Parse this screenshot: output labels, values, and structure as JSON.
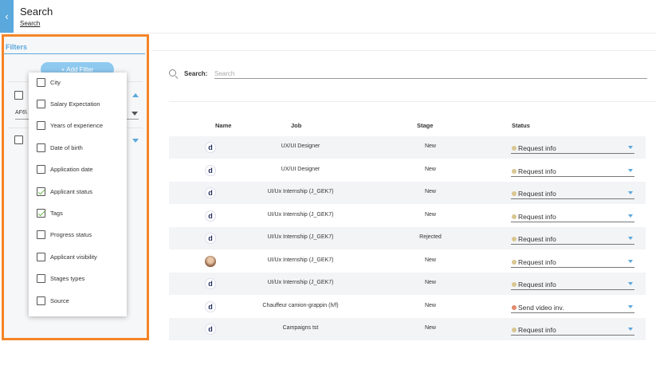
{
  "header": {
    "back_icon": "chevron-left-icon",
    "title": "Search",
    "breadcrumb": "Search"
  },
  "filters": {
    "heading": "Filters",
    "add_filter_label": "+ Add Filter",
    "partial_filter_value": "AF6\\"
  },
  "dropdown": {
    "items": [
      {
        "label": "City",
        "checked": false
      },
      {
        "label": "Salary Expectation",
        "checked": false
      },
      {
        "label": "Years of experience",
        "checked": false
      },
      {
        "label": "Date of birth",
        "checked": false
      },
      {
        "label": "Application date",
        "checked": false
      },
      {
        "label": "Applicant status",
        "checked": true
      },
      {
        "label": "Tags",
        "checked": true
      },
      {
        "label": "Progress status",
        "checked": false
      },
      {
        "label": "Applicant visibility",
        "checked": false
      },
      {
        "label": "Stages types",
        "checked": false
      },
      {
        "label": "Source",
        "checked": false
      }
    ]
  },
  "search": {
    "label": "Search:",
    "placeholder": "Search",
    "value": ""
  },
  "table": {
    "headers": {
      "name": "Name",
      "job": "Job",
      "stage": "Stage",
      "status": "Status"
    },
    "rows": [
      {
        "avatar": "d",
        "photo": false,
        "job": "UX/UI Designer",
        "stage": "New",
        "status": "Request info",
        "status_color": "#d9c690"
      },
      {
        "avatar": "d",
        "photo": false,
        "job": "UX/UI Designer",
        "stage": "New",
        "status": "Request info",
        "status_color": "#d9c690"
      },
      {
        "avatar": "d",
        "photo": false,
        "job": "UI/Ux Internship (J_GEK7)",
        "stage": "New",
        "status": "Request info",
        "status_color": "#d9c690"
      },
      {
        "avatar": "d",
        "photo": false,
        "job": "UI/Ux Internship (J_GEK7)",
        "stage": "New",
        "status": "Request info",
        "status_color": "#d9c690"
      },
      {
        "avatar": "d",
        "photo": false,
        "job": "UI/Ux Internship (J_GEK7)",
        "stage": "Rejected",
        "status": "Request info",
        "status_color": "#d9c690"
      },
      {
        "avatar": "",
        "photo": true,
        "job": "UI/Ux Internship (J_GEK7)",
        "stage": "New",
        "status": "Request info",
        "status_color": "#d9c690"
      },
      {
        "avatar": "d",
        "photo": false,
        "job": "UI/Ux Internship (J_GEK7)",
        "stage": "New",
        "status": "Request info",
        "status_color": "#d9c690"
      },
      {
        "avatar": "d",
        "photo": false,
        "job": "Chauffeur camion-grappin (h/f)",
        "stage": "New",
        "status": "Send video inv.",
        "status_color": "#e08a6a"
      },
      {
        "avatar": "d",
        "photo": false,
        "job": "Campaigns tst",
        "stage": "New",
        "status": "Request info",
        "status_color": "#d9c690"
      }
    ]
  }
}
